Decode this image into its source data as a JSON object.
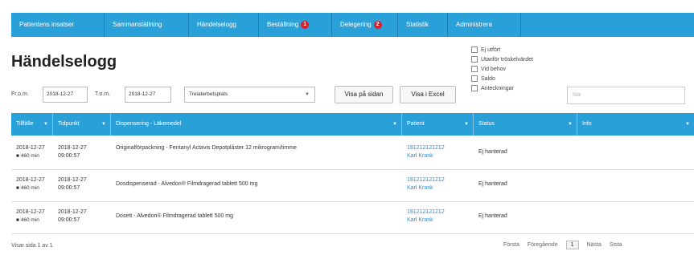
{
  "nav": {
    "tabs": [
      {
        "label": "Patientens insatser",
        "badge": ""
      },
      {
        "label": "Sammanställning",
        "badge": ""
      },
      {
        "label": "Händelselogg",
        "badge": ""
      },
      {
        "label": "Beställning",
        "badge": "1"
      },
      {
        "label": "Delegering",
        "badge": "2"
      },
      {
        "label": "Statistik",
        "badge": ""
      },
      {
        "label": "Administrera",
        "badge": ""
      }
    ]
  },
  "page": {
    "title": "Händelselogg"
  },
  "filters": {
    "from_label": "Fr.o.m.",
    "from_value": "2018-12-27",
    "to_label": "T.o.m.",
    "to_value": "2018-12-27",
    "location_value": "Trelaterbetsplats",
    "show_on_page_label": "Visa på sidan",
    "show_in_excel_label": "Visa i Excel",
    "search_placeholder": "Sök"
  },
  "checkboxes": [
    "Ej utfört",
    "Utanför tröskelvärdet",
    "Vid behov",
    "Saldo",
    "Anteckningar"
  ],
  "table": {
    "columns": [
      "Tillfälle",
      "Tidpunkt",
      "Dispensering - Läkemedel",
      "Patient",
      "Status",
      "Info"
    ],
    "rows": [
      {
        "tillfalle": "2018-12-27",
        "duration": "460 min",
        "tidpunkt_date": "2018-12-27",
        "tidpunkt_time": "09:00:57",
        "disp": "Originalförpackning - Fentanyl Actavis Depotplåster 12 mikrogram/timme",
        "patient_id": "191212121212",
        "patient_name": "Karl Krank",
        "status": "Ej hanterad",
        "info": ""
      },
      {
        "tillfalle": "2018-12-27",
        "duration": "460 min",
        "tidpunkt_date": "2018-12-27",
        "tidpunkt_time": "09:00:57",
        "disp": "Dosdispenserad - Alvedon® Filmdragerad tablett 500 mg",
        "patient_id": "191212121212",
        "patient_name": "Karl Krank",
        "status": "Ej hanterad",
        "info": ""
      },
      {
        "tillfalle": "2018-12-27",
        "duration": "460 min",
        "tidpunkt_date": "2018-12-27",
        "tidpunkt_time": "09:00:57",
        "disp": "Dosett - Alvedon® Filmdragerad tablett 500 mg",
        "patient_id": "191212121212",
        "patient_name": "Karl Krank",
        "status": "Ej hanterad",
        "info": ""
      }
    ]
  },
  "footer": {
    "page_info": "Visar sida 1 av 1",
    "first": "Första",
    "prev": "Föregående",
    "current": "1",
    "next": "Nästa",
    "last": "Sista"
  },
  "colors": {
    "accent": "#2aa0d8",
    "badge": "#d8202a",
    "link": "#2a8fcf"
  }
}
